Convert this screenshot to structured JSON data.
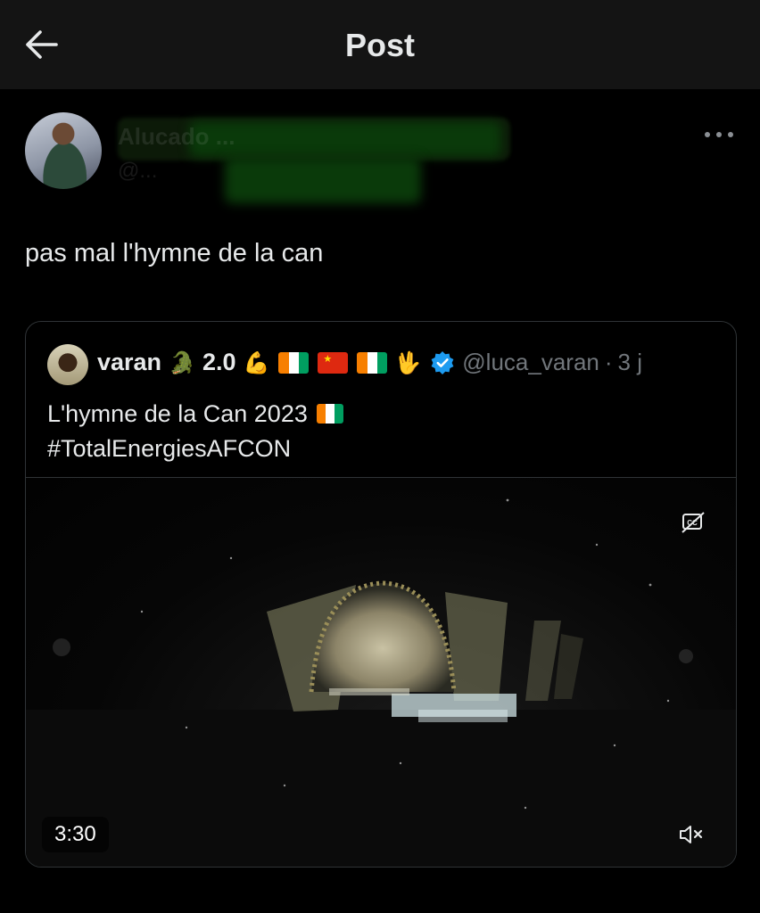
{
  "header": {
    "title": "Post",
    "back_icon": "arrow-left-icon"
  },
  "post": {
    "author_name": "Alucado ...",
    "author_handle": "@...",
    "text": "pas mal l'hymne de la can",
    "more_icon": "more-horizontal-icon"
  },
  "quote": {
    "name": "varan",
    "version": "2.0",
    "emojis": [
      "crocodile",
      "flexed-biceps",
      "flag-ci",
      "flag-cn",
      "flag-ci",
      "vulcan-salute"
    ],
    "verified": true,
    "handle": "@luca_varan",
    "separator": "·",
    "time": "3 j",
    "text_line1": "L'hymne de la Can 2023",
    "text_line2": "#TotalEnergiesAFCON"
  },
  "video": {
    "duration": "3:30",
    "captions_icon": "closed-captions-off-icon",
    "mute_icon": "volume-muted-icon"
  },
  "colors": {
    "background": "#000000",
    "header_bg": "#141414",
    "text_primary": "#e7e9ea",
    "text_secondary": "#71767b",
    "border": "#2f3336",
    "verified_blue": "#1d9bf0"
  }
}
